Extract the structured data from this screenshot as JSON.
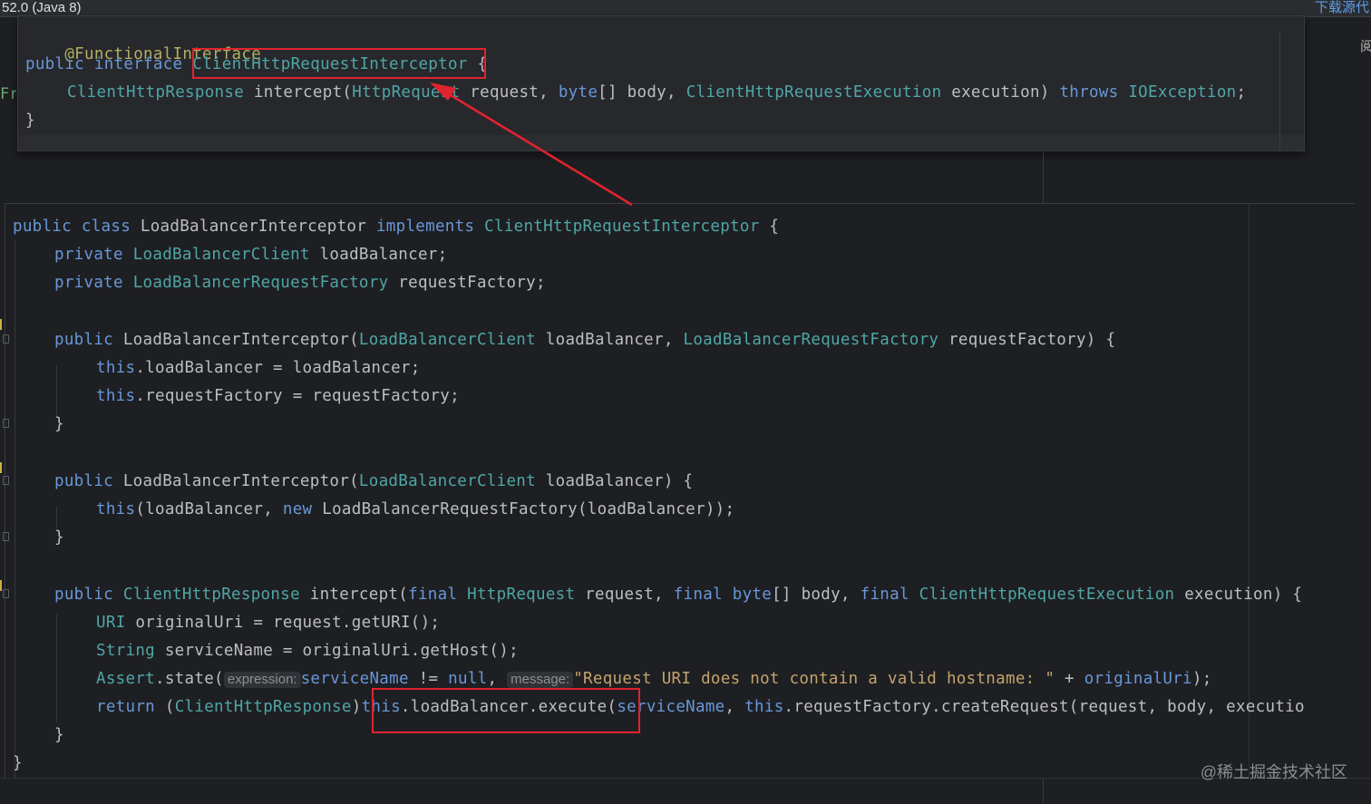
{
  "top_bar": {
    "version_text": "52.0 (Java 8)",
    "download_link": "下载源代"
  },
  "right_glyph": "阅",
  "left_fragment": "Fra",
  "popup": {
    "annotation": "@FunctionalInterface",
    "line2": {
      "mod": "public",
      "kw": "interface",
      "name": "ClientHttpRequestInterceptor",
      "brace": " {"
    },
    "line3": {
      "ret": "ClientHttpResponse",
      "method": " intercept(",
      "p1_type": "HttpRequest",
      "p1": " request, ",
      "p2_type": "byte",
      "p2": "[] body, ",
      "p3_type": "ClientHttpRequestExecution",
      "p3": " execution) ",
      "throws": "throws",
      "exc": "IOException",
      "end": ";"
    },
    "line4": "}"
  },
  "main": {
    "l1": {
      "a": "public",
      "b": "class",
      "c": " LoadBalancerInterceptor ",
      "d": "implements",
      "e": "ClientHttpRequestInterceptor",
      "f": " {"
    },
    "l2": {
      "a": "private",
      "b": "LoadBalancerClient",
      "c": " loadBalancer;"
    },
    "l3": {
      "a": "private",
      "b": "LoadBalancerRequestFactory",
      "c": " requestFactory;"
    },
    "l5": {
      "a": "public",
      "b": " LoadBalancerInterceptor(",
      "c": "LoadBalancerClient",
      "d": " loadBalancer, ",
      "e": "LoadBalancerRequestFactory",
      "f": " requestFactory) {"
    },
    "l6": {
      "a": "this",
      "b": ".loadBalancer = loadBalancer;"
    },
    "l7": {
      "a": "this",
      "b": ".requestFactory = requestFactory;"
    },
    "l8": "}",
    "l10": {
      "a": "public",
      "b": " LoadBalancerInterceptor(",
      "c": "LoadBalancerClient",
      "d": " loadBalancer) {"
    },
    "l11": {
      "a": "this",
      "b": "(loadBalancer, ",
      "c": "new",
      "d": " LoadBalancerRequestFactory(loadBalancer));"
    },
    "l12": "}",
    "l14": {
      "a": "public",
      "b": "ClientHttpResponse",
      "c": " intercept(",
      "d": "final",
      "e": "HttpRequest",
      "f": " request, ",
      "g": "final",
      "h": "byte",
      "i": "[] body, ",
      "j": "final",
      "k": "ClientHttpRequestExecution",
      "l": " execution) ",
      "m": "{"
    },
    "l15": {
      "a": "URI",
      "b": " originalUri = request.getURI();"
    },
    "l16": {
      "a": "String",
      "b": " serviceName = originalUri.getHost();"
    },
    "l17": {
      "a": "Assert",
      "b": ".state(",
      "hint1": "expression:",
      "c": "serviceName",
      "d": " != ",
      "e": "null",
      "f": ", ",
      "hint2": "message:",
      "g": "\"Request URI does not contain a valid hostname: \"",
      "h": " + ",
      "i": "originalUri",
      "j": ");"
    },
    "l18": {
      "a": "return",
      "b": " (",
      "c": "ClientHttpResponse",
      "d": ")",
      "e": "this",
      "f": ".loadBalancer.execute(",
      "g": "serviceName",
      "h": ", ",
      "i": "this",
      "j": ".requestFactory.createRequest(request, body, executio"
    },
    "l19": "}",
    "l20": "}"
  },
  "watermark": "@稀土掘金技术社区",
  "colors": {
    "keyword": "#6897d8",
    "type": "#4fa6a6",
    "annotation": "#b3ae60",
    "string": "#c3a36e",
    "highlight_box": "#e0242f"
  }
}
